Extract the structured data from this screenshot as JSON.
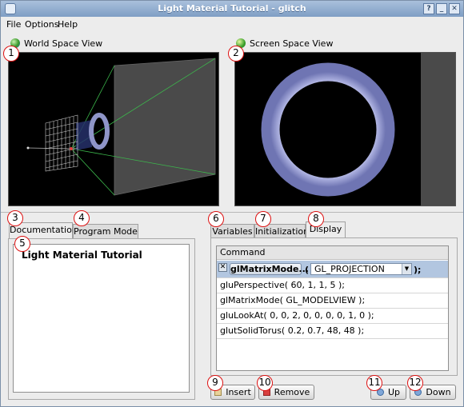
{
  "window": {
    "title": "Light Material Tutorial - glitch"
  },
  "menu": [
    "File",
    "Options",
    "Help"
  ],
  "world_view": {
    "label": "World Space View"
  },
  "screen_view": {
    "label": "Screen Space View"
  },
  "left_tabs": [
    "Documentation",
    "Program Mode"
  ],
  "doc": {
    "title": "Light Material Tutorial"
  },
  "right_tabs": [
    "Variables",
    "Initialization",
    "Display"
  ],
  "commands": {
    "header": "Command",
    "selected": {
      "function": "glMatrixMode...",
      "open_paren": "(",
      "argument": "GL_PROJECTION",
      "close": ");"
    },
    "rows": [
      "gluPerspective( 60, 1, 1, 5 );",
      "glMatrixMode( GL_MODELVIEW );",
      "gluLookAt( 0, 0, 2, 0, 0, 0, 0, 1, 0 );",
      "glutSolidTorus( 0.2, 0.7, 48, 48 );"
    ]
  },
  "buttons": {
    "insert": "Insert",
    "remove": "Remove",
    "up": "Up",
    "down": "Down"
  },
  "callouts": [
    "1",
    "2",
    "3",
    "4",
    "5",
    "6",
    "7",
    "8",
    "9",
    "10",
    "11",
    "12"
  ],
  "colors": {
    "title_bar": "#8fabd0",
    "selection": "#b2c6e0",
    "callout_border": "#dd1111"
  }
}
